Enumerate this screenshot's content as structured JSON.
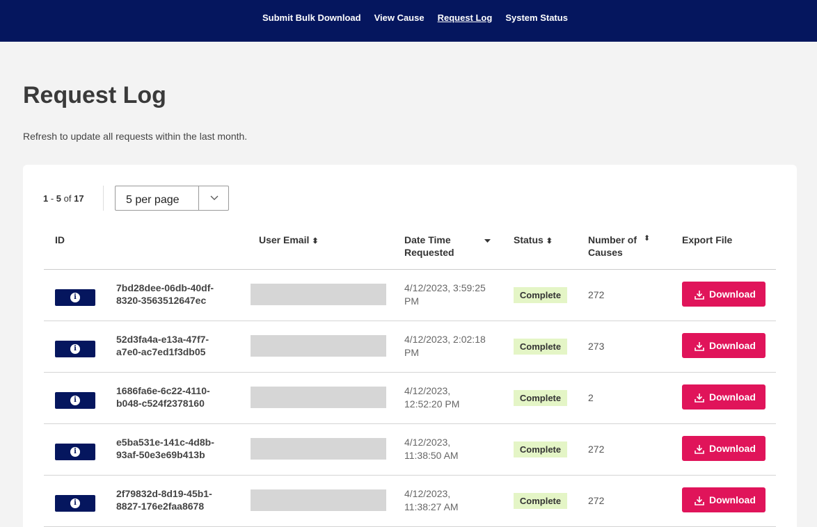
{
  "nav": {
    "items": [
      {
        "label": "Submit Bulk Download"
      },
      {
        "label": "View Cause"
      },
      {
        "label": "Request Log",
        "active": true
      },
      {
        "label": "System Status"
      }
    ]
  },
  "page": {
    "title": "Request Log",
    "subtitle": "Refresh to update all requests within the last month."
  },
  "pager": {
    "range_start": "1",
    "range_sep": " - ",
    "range_end": "5",
    "of_text": " of ",
    "total": "17",
    "per_page": "5 per page"
  },
  "table": {
    "headers": {
      "id": "ID",
      "email": "User Email",
      "date_line1": "Date Time",
      "date_line2": "Requested",
      "status": "Status",
      "causes_line1": "Number of",
      "causes_line2": "Causes",
      "export": "Export File"
    },
    "rows": [
      {
        "id_line1": "7bd28dee-06db-40df-",
        "id_line2": "8320-3563512647ec",
        "date_line1": "4/12/2023, 3:59:25",
        "date_line2": "PM",
        "status": "Complete",
        "causes": "272",
        "download": "Download"
      },
      {
        "id_line1": "52d3fa4a-e13a-47f7-",
        "id_line2": "a7e0-ac7ed1f3db05",
        "date_line1": "4/12/2023, 2:02:18",
        "date_line2": "PM",
        "status": "Complete",
        "causes": "273",
        "download": "Download"
      },
      {
        "id_line1": "1686fa6e-6c22-4110-",
        "id_line2": "b048-c524f2378160",
        "date_line1": "4/12/2023,",
        "date_line2": "12:52:20 PM",
        "status": "Complete",
        "causes": "2",
        "download": "Download"
      },
      {
        "id_line1": "e5ba531e-141c-4d8b-",
        "id_line2": "93af-50e3e69b413b",
        "date_line1": "4/12/2023,",
        "date_line2": "11:38:50 AM",
        "status": "Complete",
        "causes": "272",
        "download": "Download"
      },
      {
        "id_line1": "2f79832d-8d19-45b1-",
        "id_line2": "8827-176e2faa8678",
        "date_line1": "4/12/2023,",
        "date_line2": "11:38:27 AM",
        "status": "Complete",
        "causes": "272",
        "download": "Download"
      }
    ]
  },
  "icons": {
    "info": "info-icon",
    "download": "download-icon",
    "sort": "sort-icon",
    "chevron": "chevron-down-icon"
  },
  "colors": {
    "nav_bg": "#05165e",
    "accent": "#e0145a",
    "status_complete_bg": "#e4f5c6"
  }
}
